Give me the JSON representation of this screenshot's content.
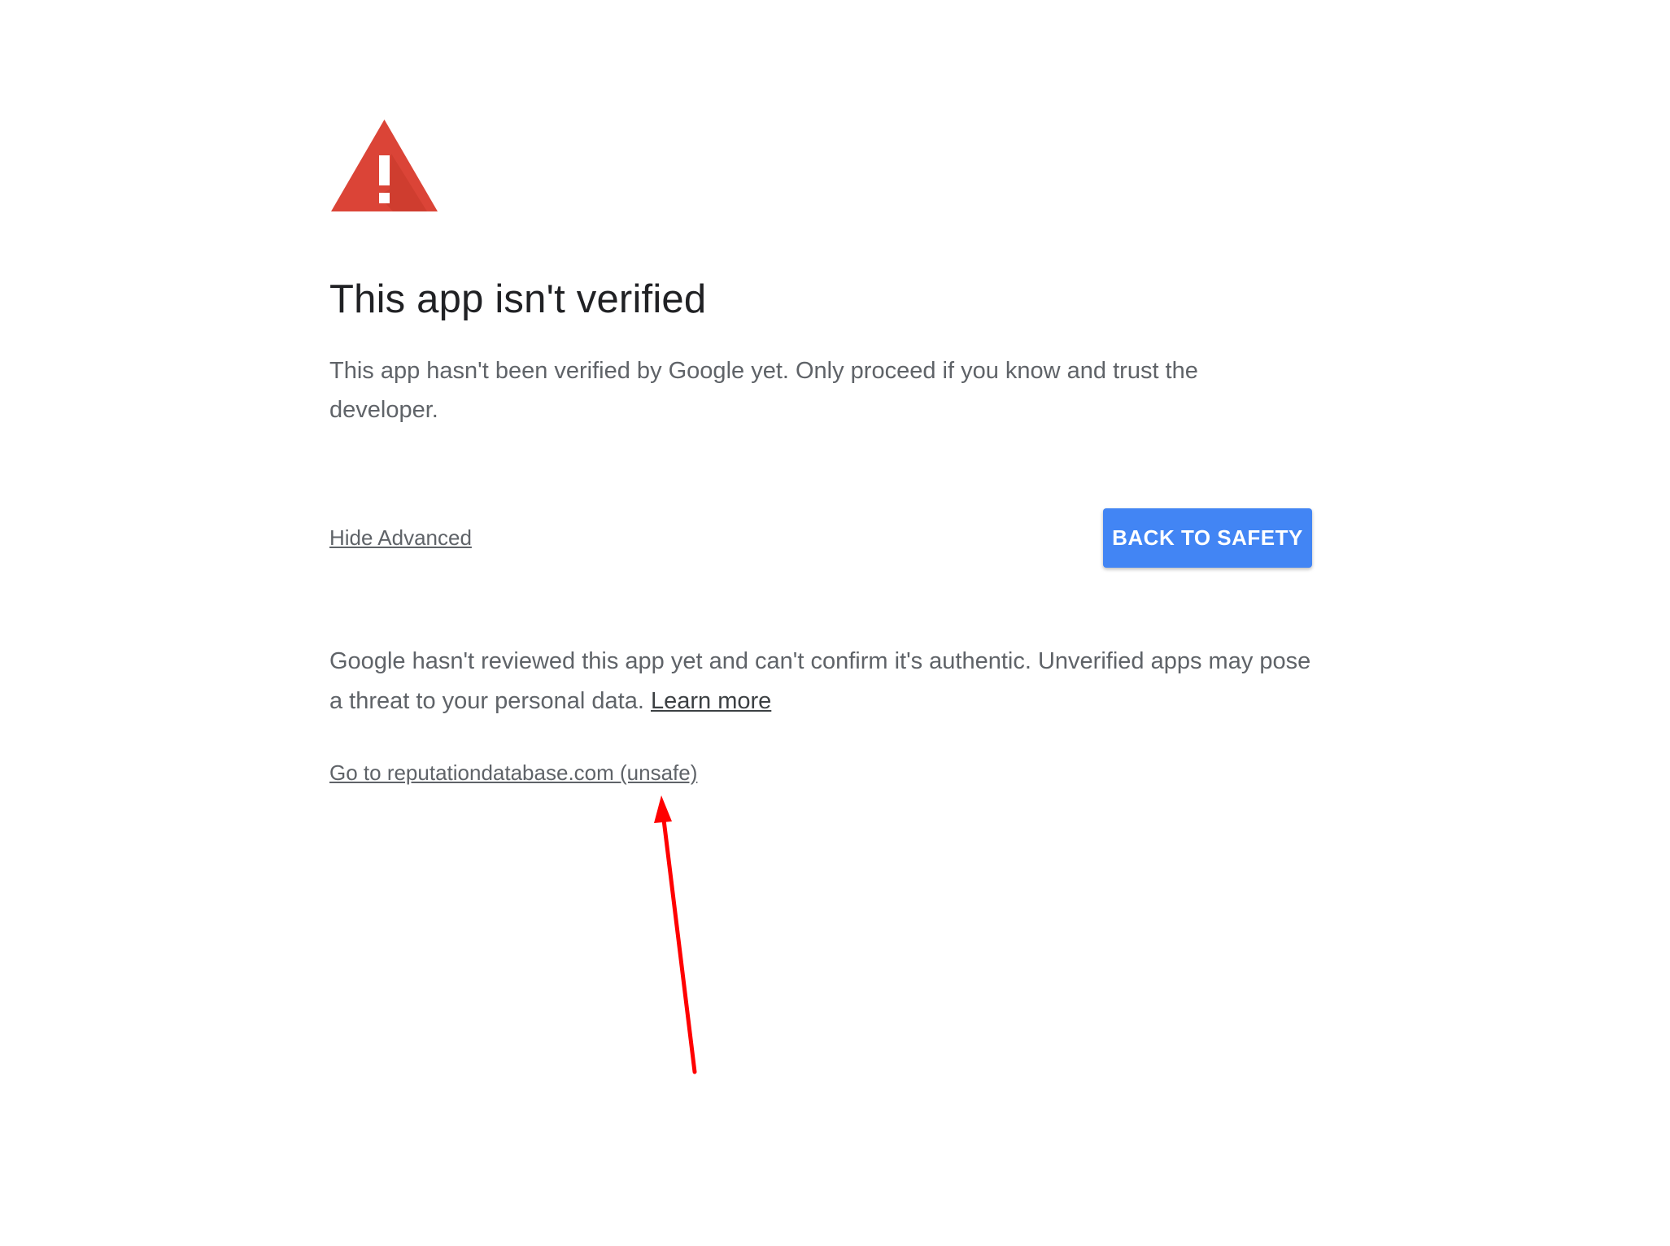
{
  "page": {
    "title": "This app isn't verified",
    "intro_text": "This app hasn't been verified by Google yet. Only proceed if you know and trust the developer.",
    "hide_advanced_label": "Hide Advanced",
    "back_button_label": "BACK TO SAFETY",
    "details_text": "Google hasn't reviewed this app yet and can't confirm it's authentic. Unverified apps may pose a threat to your personal data.",
    "learn_more_label": "Learn more",
    "proceed_link_label": "Go to reputationdatabase.com (unsafe)"
  },
  "icons": {
    "warning": "warning-triangle-icon",
    "annotation": "red-arrow-annotation"
  },
  "colors": {
    "warning_red": "#db4437",
    "button_blue": "#4285f4",
    "title_text": "#202124",
    "body_text": "#5f6368",
    "annotation_red": "#ff0000"
  }
}
